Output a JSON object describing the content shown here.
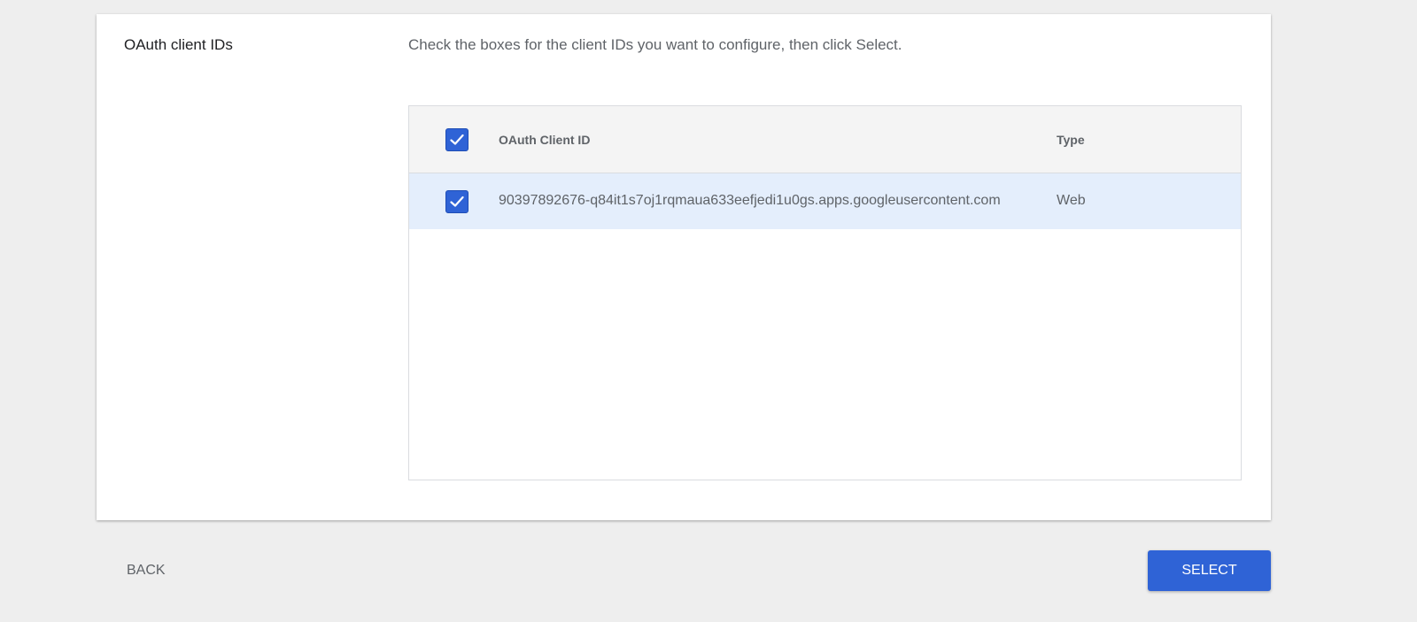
{
  "section": {
    "title": "OAuth client IDs",
    "instructions": "Check the boxes for the client IDs you want to configure, then click Select."
  },
  "table": {
    "columns": [
      "OAuth Client ID",
      "Type"
    ],
    "header_checkbox_checked": true,
    "rows": [
      {
        "checked": true,
        "client_id": "90397892676-q84it1s7oj1rqmaua633eefjedi1u0gs.apps.googleusercontent.com",
        "type": "Web"
      }
    ]
  },
  "actions": {
    "back_label": "BACK",
    "select_label": "SELECT"
  },
  "colors": {
    "accent": "#2f63d6",
    "selected_row": "#e4eefc",
    "header_bg": "#f4f4f4",
    "page_bg": "#eeeeee"
  },
  "icons": {
    "checkbox": "check-icon"
  }
}
